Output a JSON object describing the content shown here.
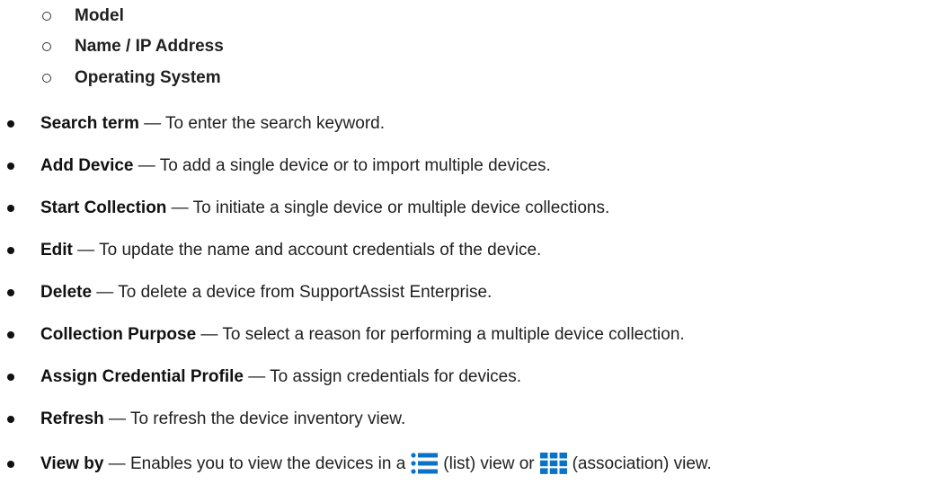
{
  "sub_items": [
    {
      "label": "Model"
    },
    {
      "label": "Name / IP Address"
    },
    {
      "label": "Operating System"
    }
  ],
  "items": [
    {
      "term": "Search term",
      "desc": " — To enter the search keyword."
    },
    {
      "term": "Add Device",
      "desc": " — To add a single device or to import multiple devices."
    },
    {
      "term": "Start Collection",
      "desc": " — To initiate a single device or multiple device collections."
    },
    {
      "term": "Edit",
      "desc": " — To update the name and account credentials of the device."
    },
    {
      "term": "Delete",
      "desc": " — To delete a device from SupportAssist Enterprise."
    },
    {
      "term": "Collection Purpose",
      "desc": " — To select a reason for performing a multiple device collection."
    },
    {
      "term": "Assign Credential Profile",
      "desc": " — To assign credentials for devices."
    },
    {
      "term": "Refresh",
      "desc": " — To refresh the device inventory view."
    }
  ],
  "view_by": {
    "term": "View by",
    "desc_1": " — Enables you to view the devices in a",
    "list_icon": "list-icon",
    "desc_2": "(list) view or",
    "grid_icon": "grid-icon",
    "desc_3": "(association) view.",
    "icon_color": "#0a73c8"
  }
}
